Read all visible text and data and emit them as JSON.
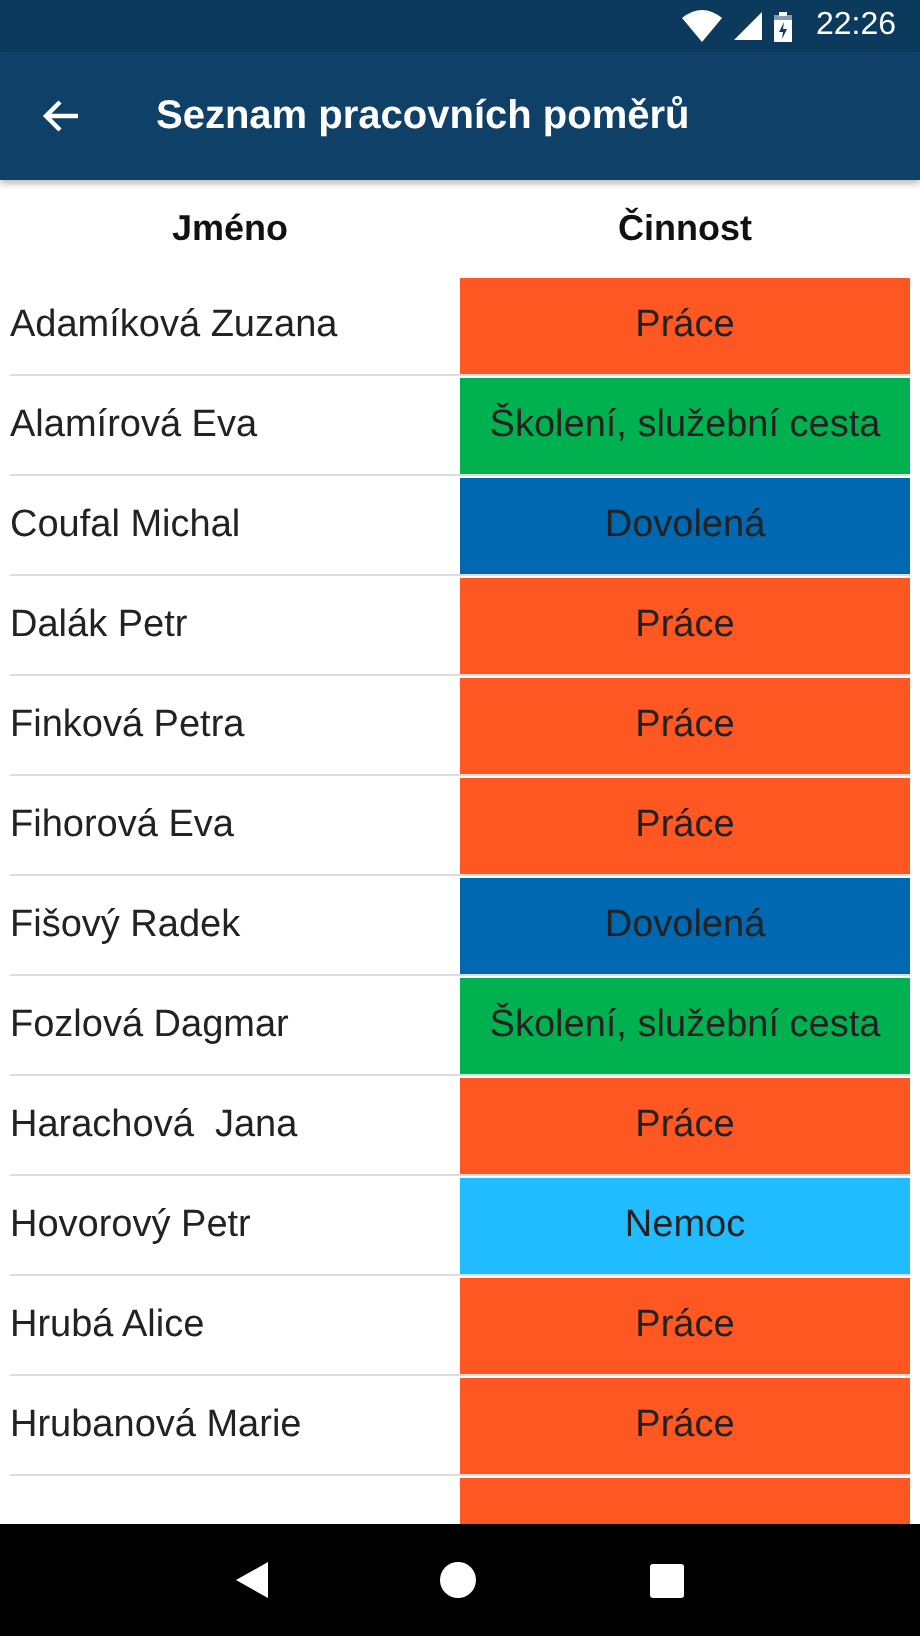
{
  "status_bar": {
    "time": "22:26"
  },
  "app_bar": {
    "title": "Seznam pracovních poměrů"
  },
  "table": {
    "columns": [
      "Jméno",
      "Činnost"
    ],
    "rows": [
      {
        "name": "Adamíková Zuzana",
        "activity": "Práce",
        "color": "#ff5722"
      },
      {
        "name": "Alamírová Eva",
        "activity": "Školení, služební cesta",
        "color": "#00b14f"
      },
      {
        "name": "Coufal Michal",
        "activity": "Dovolená",
        "color": "#0067b1"
      },
      {
        "name": "Dalák Petr",
        "activity": "Práce",
        "color": "#ff5722"
      },
      {
        "name": "Finková Petra",
        "activity": "Práce",
        "color": "#ff5722"
      },
      {
        "name": "Fihorová Eva",
        "activity": "Práce",
        "color": "#ff5722"
      },
      {
        "name": "Fišový Radek",
        "activity": "Dovolená",
        "color": "#0067b1"
      },
      {
        "name": "Fozlová Dagmar",
        "activity": "Školení, služební cesta",
        "color": "#00b14f"
      },
      {
        "name": "Harachová  Jana",
        "activity": "Práce",
        "color": "#ff5722"
      },
      {
        "name": "Hovorový Petr",
        "activity": "Nemoc",
        "color": "#21bcff"
      },
      {
        "name": "Hrubá Alice",
        "activity": "Práce",
        "color": "#ff5722"
      },
      {
        "name": "Hrubanová Marie",
        "activity": "Práce",
        "color": "#ff5722"
      }
    ],
    "partial_row": {
      "color": "#ff5722"
    }
  }
}
